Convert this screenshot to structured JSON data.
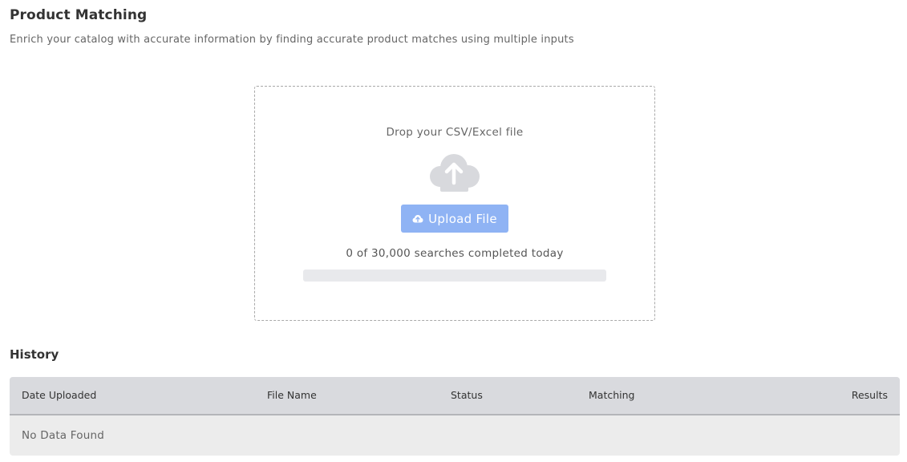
{
  "header": {
    "title": "Product Matching",
    "subtitle": "Enrich your catalog with accurate information by finding accurate product matches using multiple inputs"
  },
  "upload": {
    "drop_text": "Drop your CSV/Excel file",
    "cloud_icon": "cloud-upload-icon",
    "button_label": "Upload File",
    "button_icon": "cloud-upload-icon",
    "usage_text": "0 of 30,000 searches completed today",
    "usage_completed": 0,
    "usage_limit": 30000,
    "progress_fraction": 0,
    "colors": {
      "button": "#8fb3f4",
      "cloud": "#d8d9dd",
      "track": "#e8e9ec"
    }
  },
  "history": {
    "title": "History",
    "columns": [
      "Date Uploaded",
      "File Name",
      "Status",
      "Matching",
      "Results"
    ],
    "rows": [],
    "empty_text": "No Data Found",
    "colors": {
      "header_bg": "#d9dade",
      "body_bg": "#ececec"
    }
  }
}
